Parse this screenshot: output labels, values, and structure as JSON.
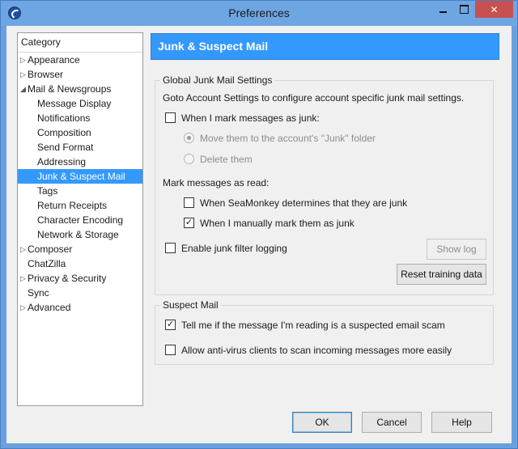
{
  "window": {
    "title": "Preferences",
    "close_label": "✕"
  },
  "sidebar": {
    "header": "Category",
    "items": [
      {
        "label": "Appearance",
        "arrow": "▷"
      },
      {
        "label": "Browser",
        "arrow": "▷"
      },
      {
        "label": "Mail & Newsgroups",
        "arrow": "◢"
      },
      {
        "label": "Message Display"
      },
      {
        "label": "Notifications"
      },
      {
        "label": "Composition"
      },
      {
        "label": "Send Format"
      },
      {
        "label": "Addressing"
      },
      {
        "label": "Junk & Suspect Mail"
      },
      {
        "label": "Tags"
      },
      {
        "label": "Return Receipts"
      },
      {
        "label": "Character Encoding"
      },
      {
        "label": "Network & Storage"
      },
      {
        "label": "Composer",
        "arrow": "▷"
      },
      {
        "label": "ChatZilla"
      },
      {
        "label": "Privacy & Security",
        "arrow": "▷"
      },
      {
        "label": "Sync"
      },
      {
        "label": "Advanced",
        "arrow": "▷"
      }
    ]
  },
  "panel": {
    "title": "Junk & Suspect Mail",
    "global": {
      "title": "Global Junk Mail Settings",
      "intro": "Goto Account Settings to configure account specific junk mail settings.",
      "mark_junk_label": "When I mark messages as junk:",
      "mark_junk_checked": "",
      "move_label": "Move them to the account's \"Junk\" folder",
      "delete_label": "Delete them",
      "mark_read_label": "Mark messages as read:",
      "seamonkey_label": "When SeaMonkey determines that they are junk",
      "seamonkey_checked": "",
      "manual_label": "When I manually mark them as junk",
      "manual_checked": "✓",
      "logging_label": "Enable junk filter logging",
      "logging_checked": "",
      "show_log_label": "Show log",
      "reset_label": "Reset training data"
    },
    "suspect": {
      "title": "Suspect Mail",
      "scam_label": "Tell me if the message I'm reading is a suspected email scam",
      "scam_checked": "✓",
      "antivirus_label": "Allow anti-virus clients to scan incoming messages more easily",
      "antivirus_checked": ""
    }
  },
  "footer": {
    "ok_label": "OK",
    "cancel_label": "Cancel",
    "help_label": "Help"
  },
  "colors": {
    "accent": "#3399ff",
    "titlebar": "#6ea5e3",
    "close": "#c75050"
  }
}
